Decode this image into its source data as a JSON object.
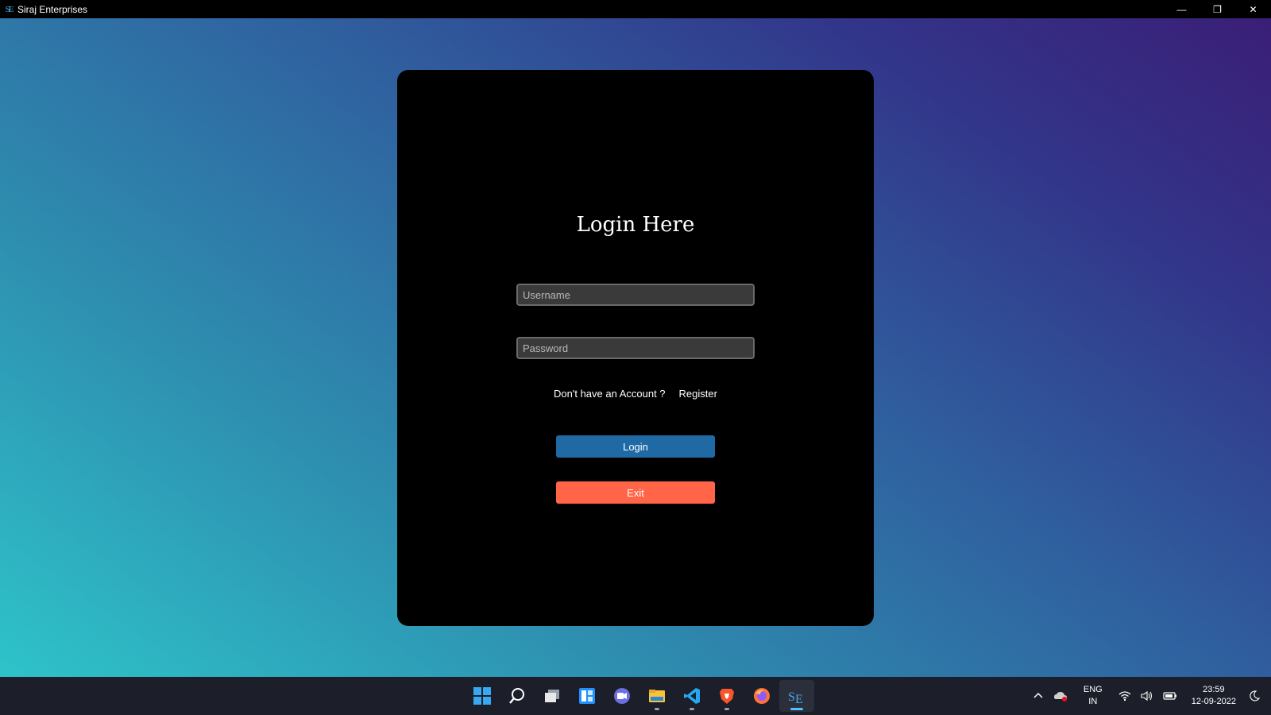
{
  "window": {
    "app_icon_text": "SE",
    "title": "Siraj Enterprises",
    "minimize_glyph": "—",
    "restore_glyph": "❐",
    "close_glyph": "✕"
  },
  "login": {
    "heading": "Login Here",
    "username_placeholder": "Username",
    "password_placeholder": "Password",
    "account_prompt": "Don't have an Account ?",
    "register_label": "Register",
    "login_button": "Login",
    "exit_button": "Exit"
  },
  "colors": {
    "login_button": "#1f6aa5",
    "exit_button": "#ff6546",
    "card_background": "#000000"
  },
  "taskbar": {
    "pinned": [
      {
        "name": "start-icon"
      },
      {
        "name": "search-icon"
      },
      {
        "name": "task-view-icon"
      },
      {
        "name": "widgets-icon"
      },
      {
        "name": "chat-icon"
      },
      {
        "name": "file-explorer-icon"
      },
      {
        "name": "vscode-icon"
      },
      {
        "name": "brave-icon"
      },
      {
        "name": "firefox-icon"
      },
      {
        "name": "siraj-app-icon",
        "active": true
      }
    ],
    "tray": {
      "language_line1": "ENG",
      "language_line2": "IN",
      "time": "23:59",
      "date": "12-09-2022"
    }
  }
}
